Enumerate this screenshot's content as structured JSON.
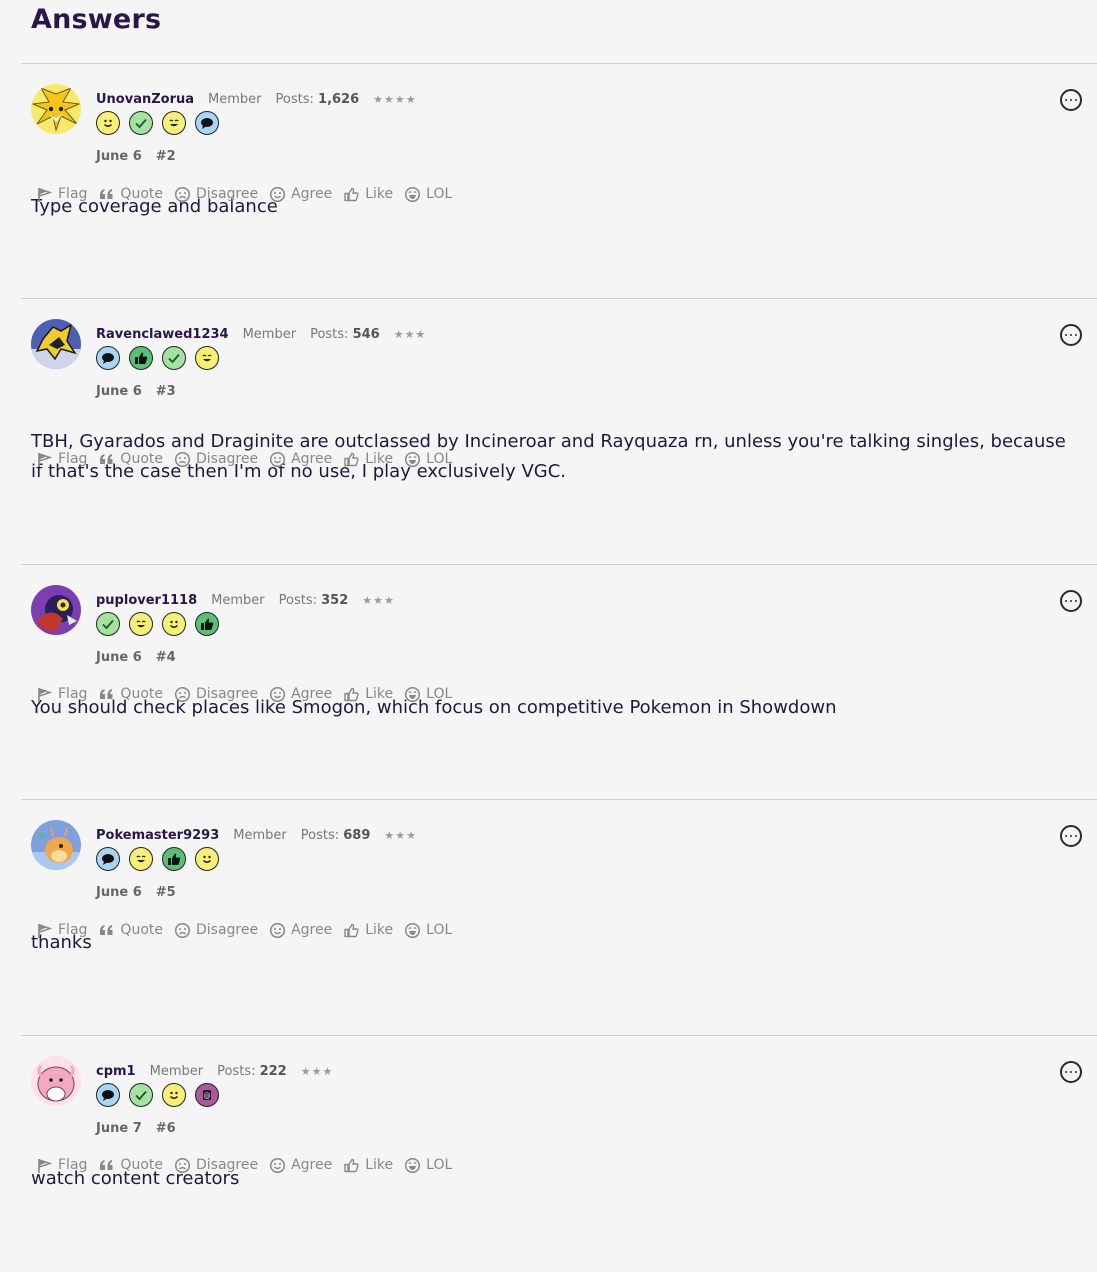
{
  "page": {
    "title": "Answers"
  },
  "actions": [
    "Flag",
    "Quote",
    "Disagree",
    "Agree",
    "Like",
    "LOL"
  ],
  "colors": {
    "title": "#2a1648",
    "text": "#22183d",
    "muted": "#888888",
    "divider": "#cfcfcf",
    "smile_badge": "#f8ef76",
    "agree_badge": "#a5e1a0",
    "chat_badge": "#a8d5f3",
    "like_badge": "#59c07a",
    "special_badge": "#a85a9b"
  },
  "posts": [
    {
      "username": "UnovanZorua",
      "role": "Member",
      "posts_label": "Posts:",
      "posts_count": "1,626",
      "stars": "★★★★",
      "badges": [
        "smile-badge",
        "agree-badge",
        "wink-badge",
        "chat-badge"
      ],
      "avatar": "jolteon-avatar",
      "date": "June 6",
      "number": "#2",
      "body": "Type coverage and balance"
    },
    {
      "username": "Ravenclawed1234",
      "role": "Member",
      "posts_label": "Posts:",
      "posts_count": "546",
      "stars": "★★★",
      "badges": [
        "chat-badge",
        "like-badge",
        "agree-badge",
        "wink-badge"
      ],
      "avatar": "zeraora-avatar",
      "date": "June 6",
      "number": "#3",
      "body": "TBH, Gyarados and Draginite are outclassed by Incineroar and Rayquaza rn, unless you're talking singles, because if that's the case then I'm of no use, I play exclusively VGC."
    },
    {
      "username": "puplover1118",
      "role": "Member",
      "posts_label": "Posts:",
      "posts_count": "352",
      "stars": "★★★",
      "badges": [
        "agree-badge",
        "wink-badge",
        "smile-badge",
        "like-badge"
      ],
      "avatar": "pokemon-avatar",
      "date": "June 6",
      "number": "#4",
      "body": "You should check places like Smogon, which focus on competitive Pokemon in Showdown"
    },
    {
      "username": "Pokemaster9293",
      "role": "Member",
      "posts_label": "Posts:",
      "posts_count": "689",
      "stars": "★★★",
      "badges": [
        "chat-badge",
        "wink-badge",
        "like-badge",
        "smile-badge"
      ],
      "avatar": "dragonite-avatar",
      "date": "June 6",
      "number": "#5",
      "body": "thanks"
    },
    {
      "username": "cpm1",
      "role": "Member",
      "posts_label": "Posts:",
      "posts_count": "222",
      "stars": "★★★",
      "badges": [
        "chat-badge",
        "agree-badge",
        "smile-badge",
        "special-badge"
      ],
      "avatar": "chansey-avatar",
      "date": "June 7",
      "number": "#6",
      "body": "watch content creators"
    }
  ]
}
